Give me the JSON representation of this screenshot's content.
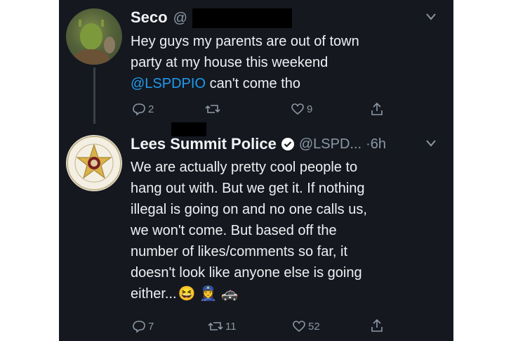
{
  "tweet1": {
    "display_name": "Seco",
    "handle_prefix": "@",
    "body_line1": "Hey guys my parents are out of town",
    "body_line2": "party at my house this weekend",
    "mention": "@LSPDPIO",
    "body_after_mention": " can't come tho",
    "actions": {
      "replies": "2",
      "retweets": "",
      "likes": "9"
    }
  },
  "tweet2": {
    "display_name": "Lees Summit Police",
    "handle": "@LSPD...",
    "time": "·6h",
    "body_lines": [
      "We are actually pretty cool people to",
      "hang out with.  But we get it.  If nothing",
      "illegal is going on and no one calls us,",
      "we won't come.  But based off the",
      "number of likes/comments so far, it",
      "doesn't look like anyone else is going"
    ],
    "body_last": "either...",
    "emoji": [
      "😆",
      "👮‍♀️",
      "🚓"
    ],
    "actions": {
      "replies": "7",
      "retweets": "11",
      "likes": "52"
    },
    "avatar_text": {
      "top": "LEES SUMMIT POLICE DEPARTMENT",
      "bottom": "150 YEARS"
    }
  },
  "colors": {
    "background": "#15181f",
    "link": "#1d9bf0",
    "muted": "#8b98a5",
    "verified": "#ffffff"
  }
}
